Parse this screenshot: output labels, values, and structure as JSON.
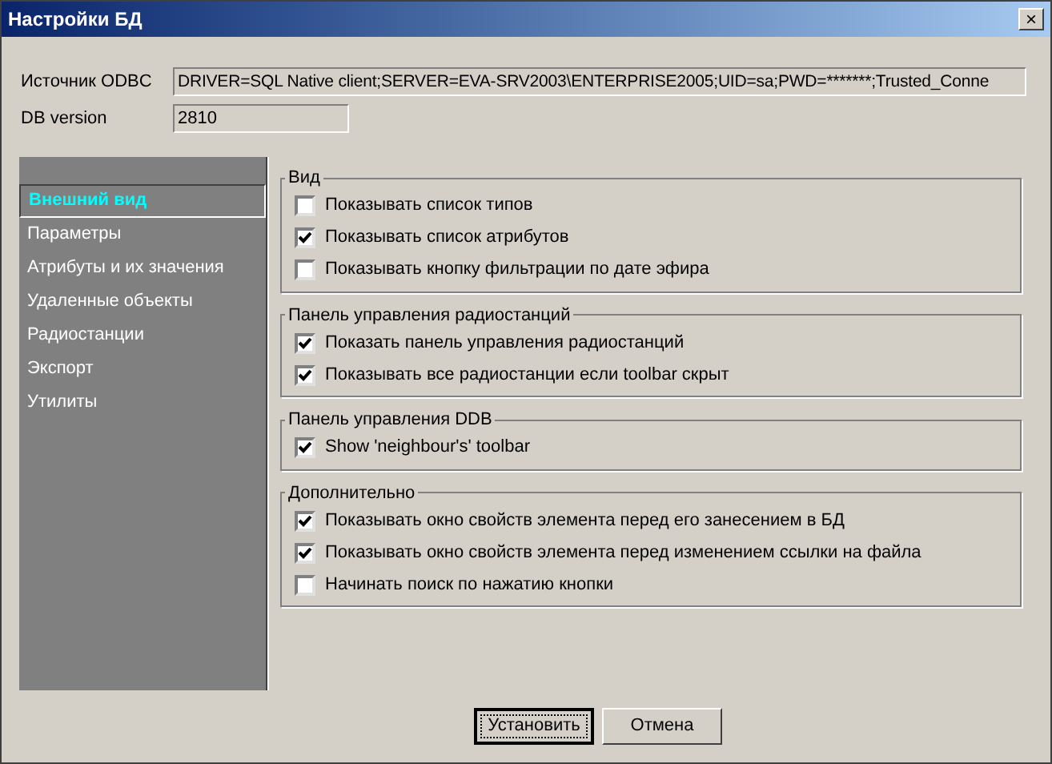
{
  "window": {
    "title": "Настройки БД",
    "close": "×"
  },
  "fields": [
    {
      "label": "Источник ODBC",
      "value": "DRIVER=SQL Native client;SERVER=EVA-SRV2003\\ENTERPRISE2005;UID=sa;PWD=*******;Trusted_Conne",
      "wide": true
    },
    {
      "label": "DB version",
      "value": "2810",
      "wide": false
    }
  ],
  "sidebar": {
    "items": [
      {
        "label": "Внешний вид",
        "selected": true
      },
      {
        "label": "Параметры",
        "selected": false
      },
      {
        "label": "Атрибуты и их значения",
        "selected": false
      },
      {
        "label": "Удаленные объекты",
        "selected": false
      },
      {
        "label": "Радиостанции",
        "selected": false
      },
      {
        "label": "Экспорт",
        "selected": false
      },
      {
        "label": "Утилиты",
        "selected": false
      }
    ]
  },
  "groups": [
    {
      "title": "Вид",
      "items": [
        {
          "label": "Показывать список типов",
          "checked": false
        },
        {
          "label": "Показывать список атрибутов",
          "checked": true
        },
        {
          "label": "Показывать кнопку фильтрации по дате эфира",
          "checked": false
        }
      ]
    },
    {
      "title": "Панель управления радиостанций",
      "items": [
        {
          "label": "Показать панель управления радиостанций",
          "checked": true
        },
        {
          "label": "Показывать все радиостанции если toolbar скрыт",
          "checked": true
        }
      ]
    },
    {
      "title": "Панель управления DDB",
      "items": [
        {
          "label": "Show 'neighbour's' toolbar",
          "checked": true
        }
      ]
    },
    {
      "title": "Дополнительно",
      "items": [
        {
          "label": "Показывать окно свойств элемента перед его занесением в БД",
          "checked": true
        },
        {
          "label": "Показывать окно свойств элемента перед изменением ссылки на файла",
          "checked": true
        },
        {
          "label": "Начинать поиск по нажатию кнопки",
          "checked": false
        }
      ]
    }
  ],
  "buttons": [
    {
      "label": "Установить",
      "default": true
    },
    {
      "label": "Отмена",
      "default": false
    }
  ]
}
